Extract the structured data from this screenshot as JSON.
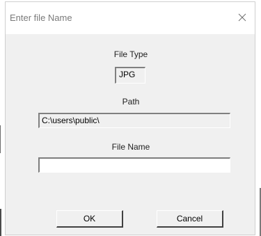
{
  "dialog": {
    "title": "Enter file Name",
    "close_icon": "close-icon"
  },
  "file_type": {
    "label": "File Type",
    "value": "JPG"
  },
  "path": {
    "label": "Path",
    "value": "C:\\users\\public\\"
  },
  "file_name": {
    "label": "File Name",
    "value": ""
  },
  "buttons": {
    "ok": "OK",
    "cancel": "Cancel"
  },
  "colors": {
    "dialog_bg": "#f0f0f0",
    "titlebar_bg": "#ffffff",
    "title_text": "#7a7a7a"
  }
}
